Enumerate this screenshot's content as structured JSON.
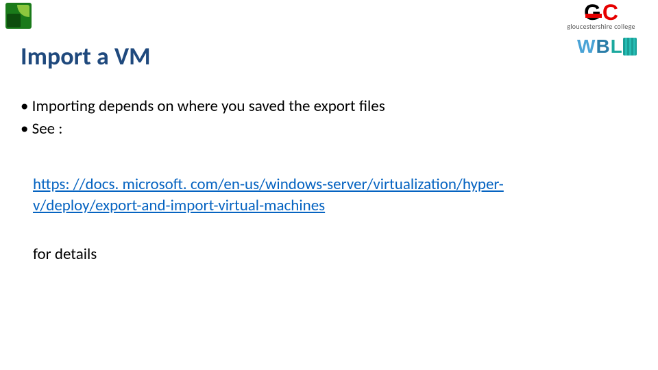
{
  "logos": {
    "bcs_alt": "bcs",
    "gc_letters": {
      "g": "G",
      "c": "C"
    },
    "gc_text": "gloucestershire college",
    "wbl": {
      "w": "W",
      "b": "B",
      "l": "L"
    }
  },
  "title": "Import a VM",
  "bullets": [
    "Importing depends on where you saved the export files",
    "See :"
  ],
  "link": {
    "line1": "https: //docs. microsoft. com/en-us/windows-server/virtualization/hyper-",
    "line2": "v/deploy/export-and-import-virtual-machines"
  },
  "details": "for details"
}
